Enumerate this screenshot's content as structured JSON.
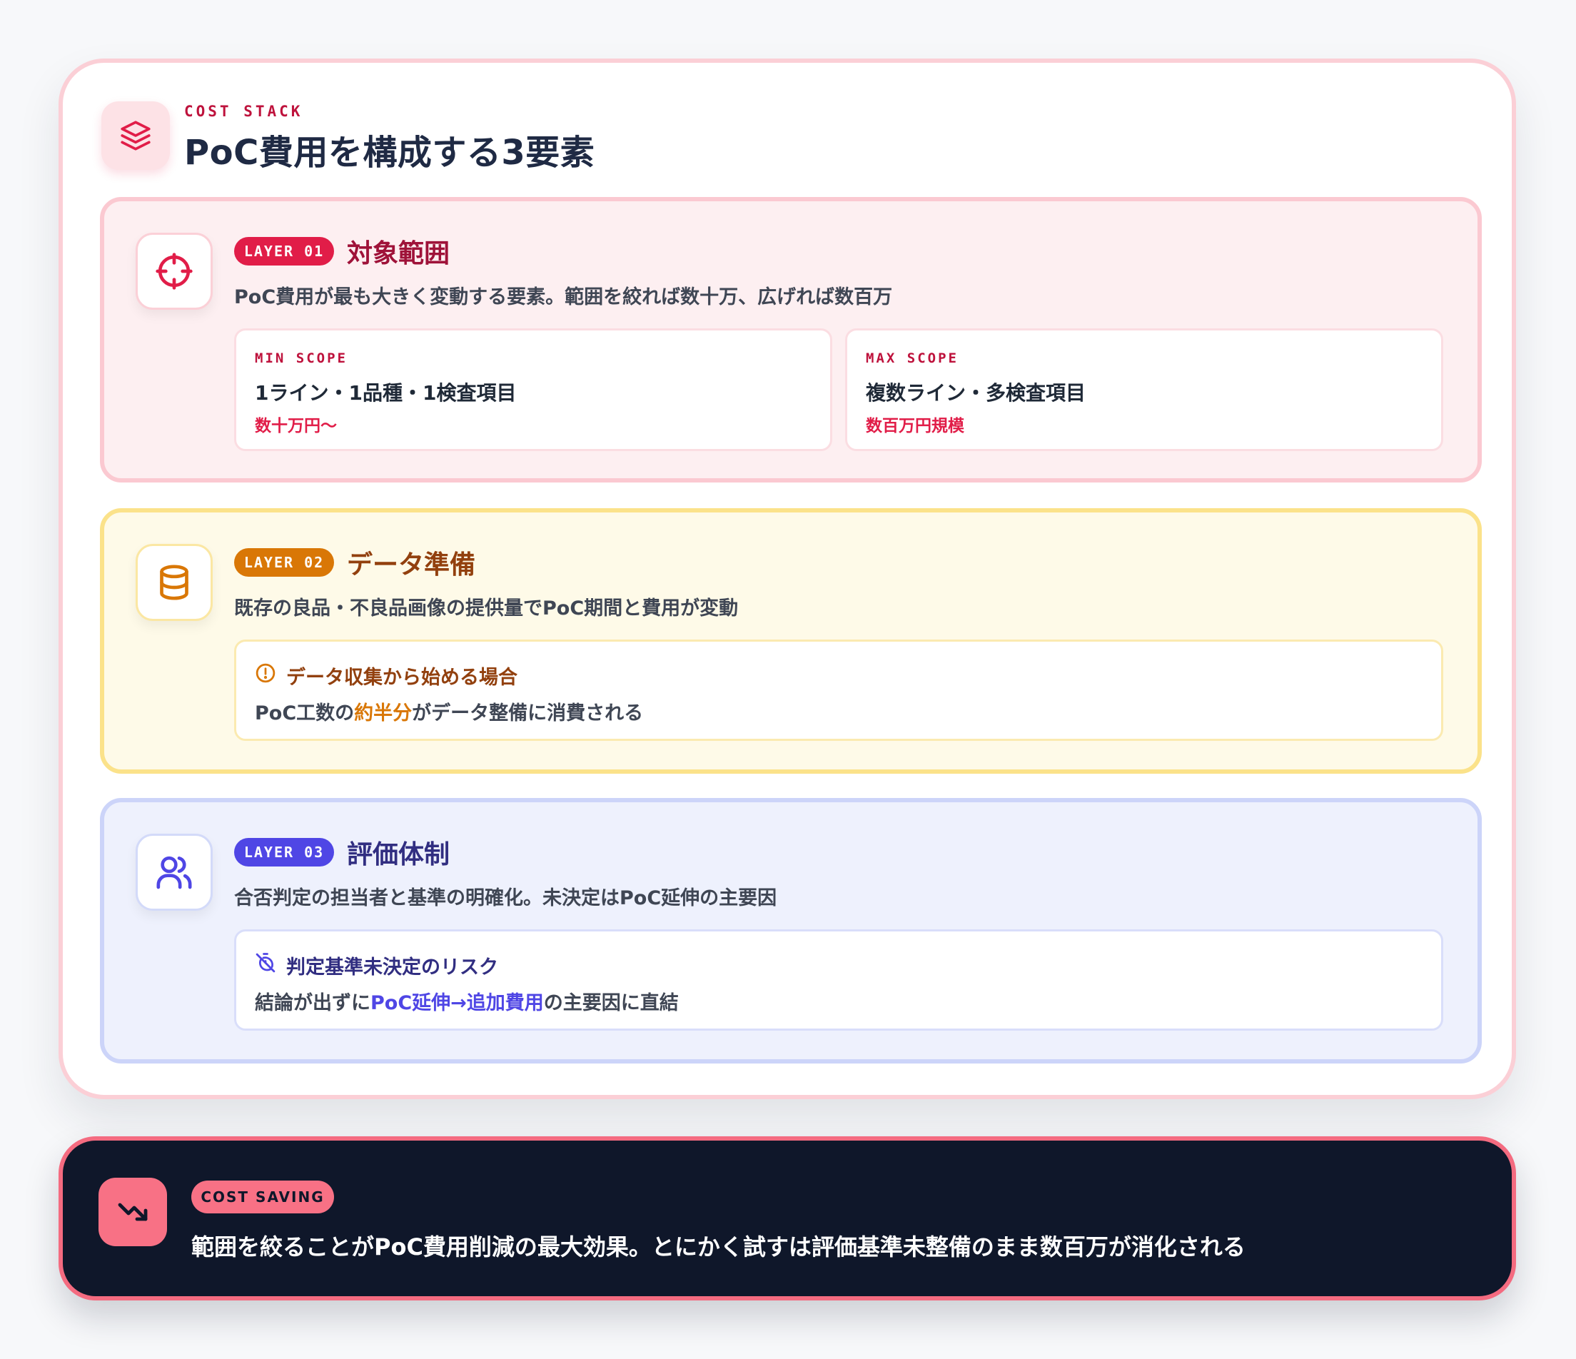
{
  "header": {
    "eyebrow": "COST STACK",
    "title": "PoC費用を構成する3要素",
    "icon": "layers-icon"
  },
  "layers": [
    {
      "badge": "LAYER 01",
      "title": "対象範囲",
      "description": "PoC費用が最も大きく変動する要素。範囲を絞れば数十万、広げれば数百万",
      "icon": "target-icon",
      "accent": "#e11d48",
      "scopes": [
        {
          "label": "MIN SCOPE",
          "value": "1ライン・1品種・1検査項目",
          "price": "数十万円〜"
        },
        {
          "label": "MAX SCOPE",
          "value": "複数ライン・多検査項目",
          "price": "数百万円規模"
        }
      ]
    },
    {
      "badge": "LAYER 02",
      "title": "データ準備",
      "description": "既存の良品・不良品画像の提供量でPoC期間と費用が変動",
      "icon": "database-icon",
      "accent": "#d97706",
      "note": {
        "icon": "alert-circle-icon",
        "title": "データ収集から始める場合",
        "body_prefix": "PoC工数の",
        "body_highlight": "約半分",
        "body_suffix": "がデータ整備に消費される"
      }
    },
    {
      "badge": "LAYER 03",
      "title": "評価体制",
      "description": "合否判定の担当者と基準の明確化。未決定はPoC延伸の主要因",
      "icon": "users-icon",
      "accent": "#4f46e5",
      "note": {
        "icon": "timer-off-icon",
        "title": "判定基準未決定のリスク",
        "body_prefix": "結論が出ずに",
        "body_highlight": "PoC延伸→追加費用",
        "body_suffix": "の主要因に直結"
      }
    }
  ],
  "saving": {
    "badge": "COST SAVING",
    "text": "範囲を絞ることがPoC費用削減の最大効果。とにかく試すは評価基準未整備のまま数百万が消化される",
    "icon": "trending-down-icon",
    "accent": "#f87185"
  }
}
